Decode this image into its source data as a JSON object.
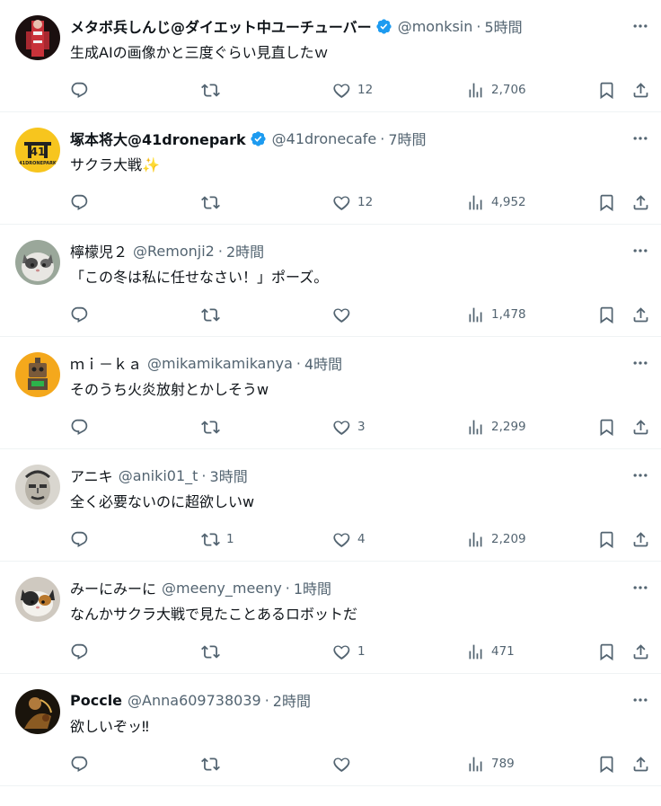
{
  "colors": {
    "text": "#0f1419",
    "muted": "#536471",
    "verified": "#1d9bf0",
    "divider": "#eff3f4"
  },
  "icons": {
    "reply": "reply-icon",
    "retweet": "retweet-icon",
    "like": "heart-icon",
    "views": "views-icon",
    "bookmark": "bookmark-icon",
    "share": "share-icon",
    "more": "more-icon",
    "verified": "verified-badge-icon"
  },
  "tweets": [
    {
      "name": "メタボ兵しんじ@ダイエット中ユーチューバー",
      "verified": true,
      "handle": "@monksin",
      "sep": "·",
      "time": "5時間",
      "text": "生成AIの画像かと三度ぐらい見直したｗ",
      "replies": "",
      "retweets": "",
      "likes": "12",
      "views": "2,706"
    },
    {
      "name": "塚本将大@41dronepark",
      "verified": true,
      "handle": "@41dronecafe",
      "sep": "·",
      "time": "7時間",
      "text": "サクラ大戦✨",
      "replies": "",
      "retweets": "",
      "likes": "12",
      "views": "4,952",
      "avatar_text": "41DRONEPARK"
    },
    {
      "name": "檸檬児２",
      "verified": false,
      "handle": "@Remonji2",
      "sep": "·",
      "time": "2時間",
      "text": "「この冬は私に任せなさい！」ポーズ。",
      "replies": "",
      "retweets": "",
      "likes": "",
      "views": "1,478"
    },
    {
      "name": "ｍｉ－ｋａ",
      "verified": false,
      "handle": "@mikamikamikanya",
      "sep": "·",
      "time": "4時間",
      "text": "そのうち火炎放射とかしそうw",
      "replies": "",
      "retweets": "",
      "likes": "3",
      "views": "2,299"
    },
    {
      "name": "アニキ",
      "verified": false,
      "handle": "@aniki01_t",
      "sep": "·",
      "time": "3時間",
      "text": "全く必要ないのに超欲しいw",
      "replies": "",
      "retweets": "1",
      "likes": "4",
      "views": "2,209"
    },
    {
      "name": "みーにみーに",
      "verified": false,
      "handle": "@meeny_meeny",
      "sep": "·",
      "time": "1時間",
      "text": "なんかサクラ大戦で見たことあるロボットだ",
      "replies": "",
      "retweets": "",
      "likes": "1",
      "views": "471"
    },
    {
      "name": "Poccle",
      "verified": false,
      "handle": "@Anna609738039",
      "sep": "·",
      "time": "2時間",
      "text": "欲しいぞッ‼",
      "replies": "",
      "retweets": "",
      "likes": "",
      "views": "789"
    }
  ]
}
